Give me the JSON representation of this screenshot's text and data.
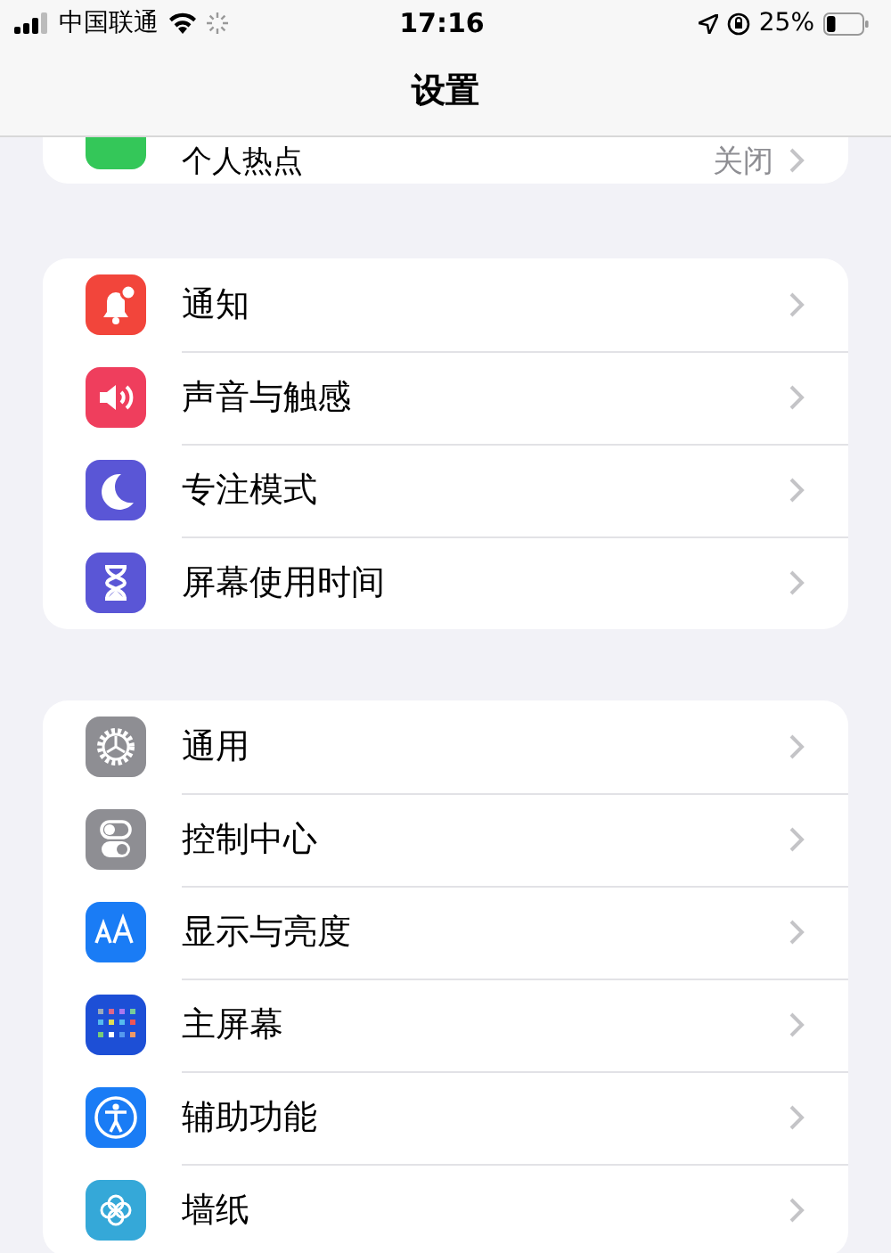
{
  "status_bar": {
    "carrier": "中国联通",
    "time": "17:16",
    "battery": "25%"
  },
  "nav_bar": {
    "title": "设置"
  },
  "groups": [
    {
      "items": [
        {
          "kind": "hotspot",
          "label": "个人热点",
          "value": "关闭",
          "partial": true
        }
      ]
    },
    {
      "items": [
        {
          "kind": "bell",
          "label": "通知"
        },
        {
          "kind": "sound",
          "label": "声音与触感"
        },
        {
          "kind": "moon",
          "label": "专注模式"
        },
        {
          "kind": "hourglass",
          "label": "屏幕使用时间"
        }
      ]
    },
    {
      "items": [
        {
          "kind": "gear",
          "label": "通用"
        },
        {
          "kind": "toggles",
          "label": "控制中心"
        },
        {
          "kind": "text",
          "label": "显示与亮度"
        },
        {
          "kind": "grid",
          "label": "主屏幕"
        },
        {
          "kind": "accessibility",
          "label": "辅助功能"
        },
        {
          "kind": "flower",
          "label": "墙纸"
        }
      ]
    }
  ]
}
